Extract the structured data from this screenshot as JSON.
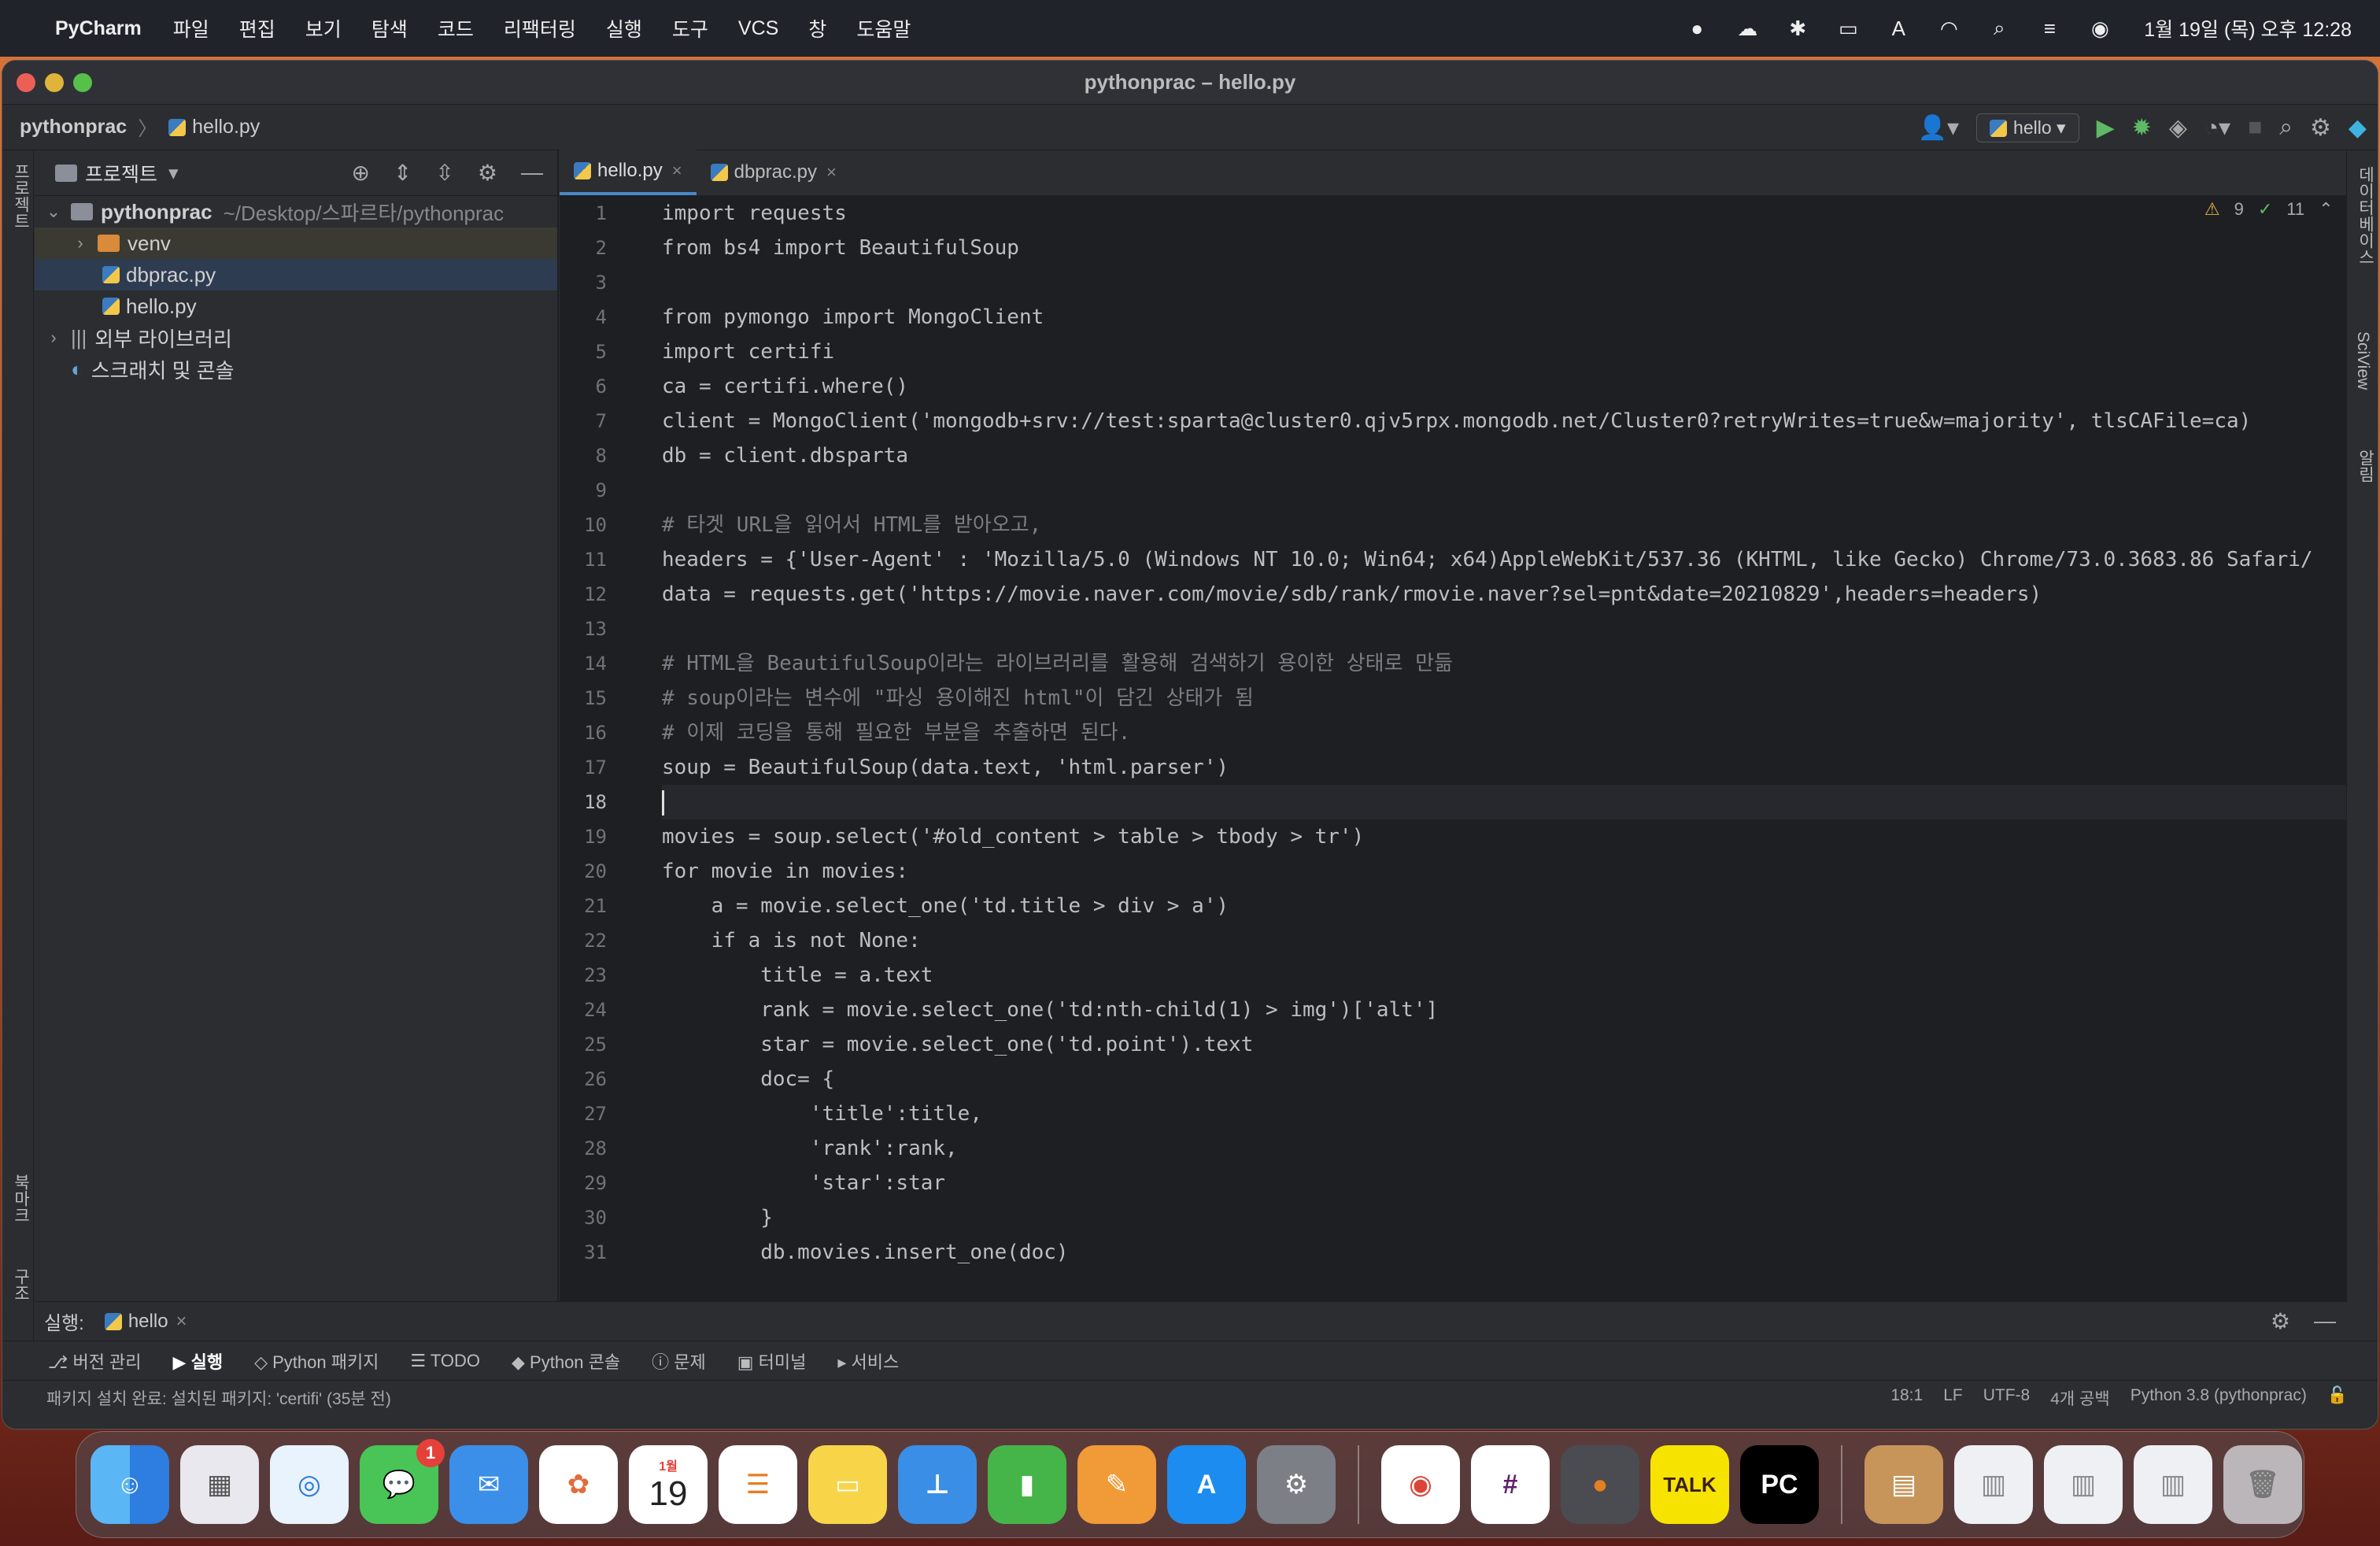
{
  "menubar": {
    "app_name": "PyCharm",
    "items": [
      "파일",
      "편집",
      "보기",
      "탐색",
      "코드",
      "리팩터링",
      "실행",
      "도구",
      "VCS",
      "창",
      "도움말"
    ],
    "clock": "1월 19일 (목) 오후 12:28"
  },
  "window": {
    "title": "pythonprac – hello.py",
    "breadcrumb_project": "pythonprac",
    "breadcrumb_file": "hello.py",
    "run_config": "hello"
  },
  "project_panel": {
    "title": "프로젝트",
    "root_name": "pythonprac",
    "root_path": "~/Desktop/스파르타/pythonprac",
    "venv": "venv",
    "file1": "dbprac.py",
    "file2": "hello.py",
    "external_libs": "외부 라이브러리",
    "scratches": "스크래치 및 콘솔"
  },
  "left_strip": {
    "project": "프로젝트",
    "bookmarks": "북마크",
    "structure": "구조"
  },
  "right_strip": {
    "database": "데이터베이스",
    "sciview": "SciView",
    "notifications": "알림"
  },
  "tabs": {
    "tab1": "hello.py",
    "tab2": "dbprac.py"
  },
  "inspections": {
    "warnings": "9",
    "weak": "11"
  },
  "code_lines": [
    "import requests",
    "from bs4 import BeautifulSoup",
    "",
    "from pymongo import MongoClient",
    "import certifi",
    "ca = certifi.where()",
    "client = MongoClient('mongodb+srv://test:sparta@cluster0.qjv5rpx.mongodb.net/Cluster0?retryWrites=true&w=majority', tlsCAFile=ca)",
    "db = client.dbsparta",
    "",
    "# 타겟 URL을 읽어서 HTML를 받아오고,",
    "headers = {'User-Agent' : 'Mozilla/5.0 (Windows NT 10.0; Win64; x64)AppleWebKit/537.36 (KHTML, like Gecko) Chrome/73.0.3683.86 Safari/",
    "data = requests.get('https://movie.naver.com/movie/sdb/rank/rmovie.naver?sel=pnt&date=20210829',headers=headers)",
    "",
    "# HTML을 BeautifulSoup이라는 라이브러리를 활용해 검색하기 용이한 상태로 만듦",
    "# soup이라는 변수에 \"파싱 용이해진 html\"이 담긴 상태가 됨",
    "# 이제 코딩을 통해 필요한 부분을 추출하면 된다.",
    "soup = BeautifulSoup(data.text, 'html.parser')",
    "",
    "movies = soup.select('#old_content > table > tbody > tr')",
    "for movie in movies:",
    "    a = movie.select_one('td.title > div > a')",
    "    if a is not None:",
    "        title = a.text",
    "        rank = movie.select_one('td:nth-child(1) > img')['alt']",
    "        star = movie.select_one('td.point').text",
    "        doc= {",
    "            'title':title,",
    "            'rank':rank,",
    "            'star':star",
    "        }",
    "        db.movies.insert_one(doc)"
  ],
  "line_numbers": [
    "1",
    "2",
    "3",
    "4",
    "5",
    "6",
    "7",
    "8",
    "9",
    "10",
    "11",
    "12",
    "13",
    "14",
    "15",
    "16",
    "17",
    "18",
    "19",
    "20",
    "21",
    "22",
    "23",
    "24",
    "25",
    "26",
    "27",
    "28",
    "29",
    "30",
    "31"
  ],
  "run_bar": {
    "label": "실행:",
    "tab": "hello"
  },
  "tool_windows": [
    "버전 관리",
    "실행",
    "Python 패키지",
    "TODO",
    "Python 콘솔",
    "문제",
    "터미널",
    "서비스"
  ],
  "status_bar": {
    "message": "패키지 설치 완료: 설치된 패키지: 'certifi' (35분 전)",
    "position": "18:1",
    "line_sep": "LF",
    "encoding": "UTF-8",
    "indent": "4개 공백",
    "interpreter": "Python 3.8 (pythonprac)"
  },
  "dock": {
    "calendar_month": "1월",
    "calendar_day": "19",
    "messages_badge": "1",
    "talk_label": "TALK",
    "pc_label": "PC"
  }
}
